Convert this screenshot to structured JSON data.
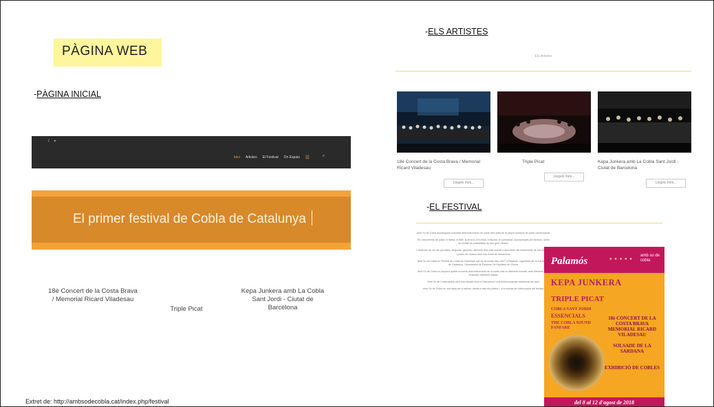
{
  "slide": {
    "title": "PÀGINA WEB",
    "footer_note": "Extret de: http://ambsodecobla.cat/index.php/festival"
  },
  "sections": {
    "home": {
      "prefix": "-",
      "label": "PÀGINA INICIAL"
    },
    "artists": {
      "prefix": "-",
      "label": "ELS ARTISTES"
    },
    "festival": {
      "prefix": "-",
      "label": "EL FESTIVAL"
    }
  },
  "home_screenshot": {
    "social": "f ✦",
    "nav_items": [
      "Inici",
      "Artistes",
      "El Festival",
      "On Espais"
    ],
    "banner_text": "El primer festival de Cobla de Catalunya",
    "captions": [
      "18è Concert de la Costa Brava / Memorial Ricard Viladesau",
      "Triple Picat",
      "Kepa Junkera amb La Cobla Sant Jordi - Ciutat de Barcelona"
    ]
  },
  "artists_screenshot": {
    "header": "Els Artistes",
    "cards": [
      {
        "name": "18è Concert de la Costa Brava / Memorial Ricard Viladesau",
        "button": "Llegeix més..."
      },
      {
        "name": "Triple Picat",
        "button": "Llegeix més..."
      },
      {
        "name": "Kepa Junkera amb La Cobla Sant Jordi - Ciutat de Barcelona",
        "button": "Llegeix més..."
      }
    ]
  },
  "festival_screenshot": {
    "paragraphs": [
      "Amb So de Cobla aconsegueix sonoritat dels instruments de cobla més enllà de la pròpia formació de cobla convencional.",
      "Els instruments de cobla: el flabiol, el tible, la tenora, el trombó, el fiscorn, el contrabaix, acompanyats pel tamborí, obren un ventall de possibilitats de bon gust i timbre.",
      "L'essència de ser tan peculiars, singulars, genuïns i diferents dels instruments s'aproximen als instruments de tots els sons i poden fer música amb tota mena de formacions.",
      "Amb So de Cobla és Festival de Cobla de Catalunya que es va iniciar l'any 2017 a Palamós, organitzat per la Generalitat de Catalunya, l'Ajuntament de Palamós i la Diputació de Girona.",
      "Amb So de Cobla us proposa quatre concerts amb instruments de la cobla, tots en diferents formats, amb diferents estils musicals i diferents espais.",
      "Amb So de Cobla també obre una mirada nova a l'instrument i a la música popular tradicional del país.",
      "Amb So de Cobla és una festa per a tothom, oberta a tots els públics, i a la música de cobla pròpia del festival."
    ],
    "poster": {
      "city": "Palamós",
      "brand": "amb so de cobla",
      "headline": "KEPA JUNKERA",
      "line2": "TRIPLE PICAT",
      "line3": "COBLA SANT JORDI",
      "line4": "ESSENCIALS",
      "line5": "THE COBLA SOUND FANFARE",
      "right1": "18è CONCERT DE LA COSTA BRAVA MEMORIAL RICARD VILADESAU",
      "right2": "SOLSADE DE LA SARDANA",
      "right3": "EXHIBICIÓ DE COBLES",
      "date": "del 8 al 12 d'agost de 2018"
    }
  }
}
